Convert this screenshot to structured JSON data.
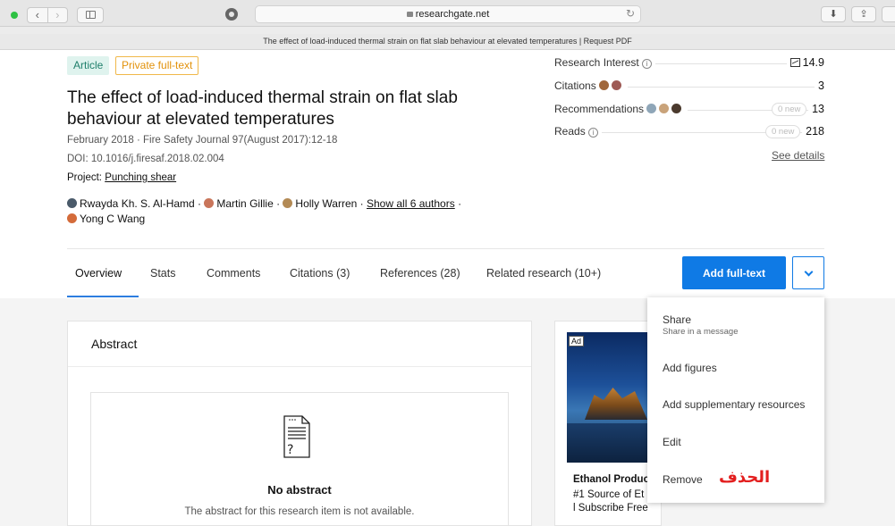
{
  "browser": {
    "url": "researchgate.net",
    "page_title": "The effect of load-induced thermal strain on flat slab behaviour at elevated temperatures | Request PDF",
    "back_glyph": "‹",
    "forward_glyph": "›",
    "reload_glyph": "↻",
    "download_glyph": "⬇",
    "share_glyph": "⇪"
  },
  "badges": {
    "article": "Article",
    "private": "Private full-text"
  },
  "publication": {
    "title": "The effect of load-induced thermal strain on flat slab behaviour at elevated temperatures",
    "date_journal": "February 2018 · Fire Safety Journal 97(August 2017):12-18",
    "doi": "DOI: 10.1016/j.firesaf.2018.02.004",
    "project_prefix": "Project: ",
    "project_link": "Punching shear",
    "authors": [
      "Rwayda Kh. S. Al-Hamd",
      "Martin Gillie",
      "Holly Warren"
    ],
    "author_sep": " · ",
    "show_all": "Show all 6 authors",
    "last_author": "Yong C Wang"
  },
  "stats": {
    "research_interest_label": "Research Interest",
    "research_interest_value": "14.9",
    "citations_label": "Citations",
    "citations_value": "3",
    "recommendations_label": "Recommendations",
    "recommendations_new": "0 new",
    "recommendations_value": "13",
    "reads_label": "Reads",
    "reads_new": "0 new",
    "reads_value": "218",
    "see_details": "See details",
    "info_glyph": "i"
  },
  "tabs": [
    "Overview",
    "Stats",
    "Comments",
    "Citations (3)",
    "References (28)",
    "Related research (10+)"
  ],
  "add_fulltext": "Add full-text",
  "abstract": {
    "heading": "Abstract",
    "empty_title": "No abstract",
    "empty_text": "The abstract for this research item is not available."
  },
  "ad": {
    "badge": "Ad",
    "line1": "Ethanol Produc",
    "line2": "#1 Source of Et",
    "line3": "l Subscribe Free"
  },
  "menu": {
    "share": "Share",
    "share_sub": "Share in a message",
    "add_figures": "Add figures",
    "add_supplementary": "Add supplementary resources",
    "edit": "Edit",
    "remove": "Remove",
    "remove_annotation": "الحذف"
  },
  "colors": {
    "primary": "#0f7ae5",
    "annotation": "#e31f1f",
    "private_badge": "#e2920c"
  }
}
